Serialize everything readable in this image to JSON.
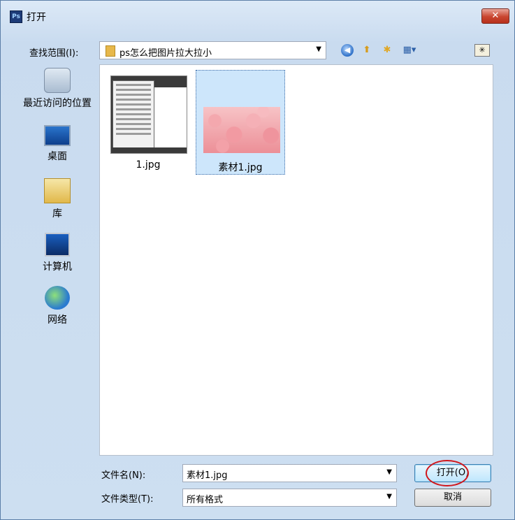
{
  "window": {
    "title": "打开",
    "app_icon": "Ps"
  },
  "lookin": {
    "label": "查找范围(I):",
    "value": "ps怎么把图片拉大拉小"
  },
  "places": [
    {
      "label": "最近访问的位置",
      "icon": "recent-places-icon"
    },
    {
      "label": "桌面",
      "icon": "desktop-icon"
    },
    {
      "label": "库",
      "icon": "libraries-icon"
    },
    {
      "label": "计算机",
      "icon": "computer-icon"
    },
    {
      "label": "网络",
      "icon": "network-icon"
    }
  ],
  "files": [
    {
      "name": "1.jpg",
      "selected": false
    },
    {
      "name": "素材1.jpg",
      "selected": true
    }
  ],
  "filename": {
    "label": "文件名(N):",
    "value": "素材1.jpg"
  },
  "filetype": {
    "label": "文件类型(T):",
    "value": "所有格式"
  },
  "buttons": {
    "open": "打开(O)",
    "cancel": "取消"
  },
  "colors": {
    "selection": "#cde6fb",
    "annotation_circle": "#d0161b"
  }
}
